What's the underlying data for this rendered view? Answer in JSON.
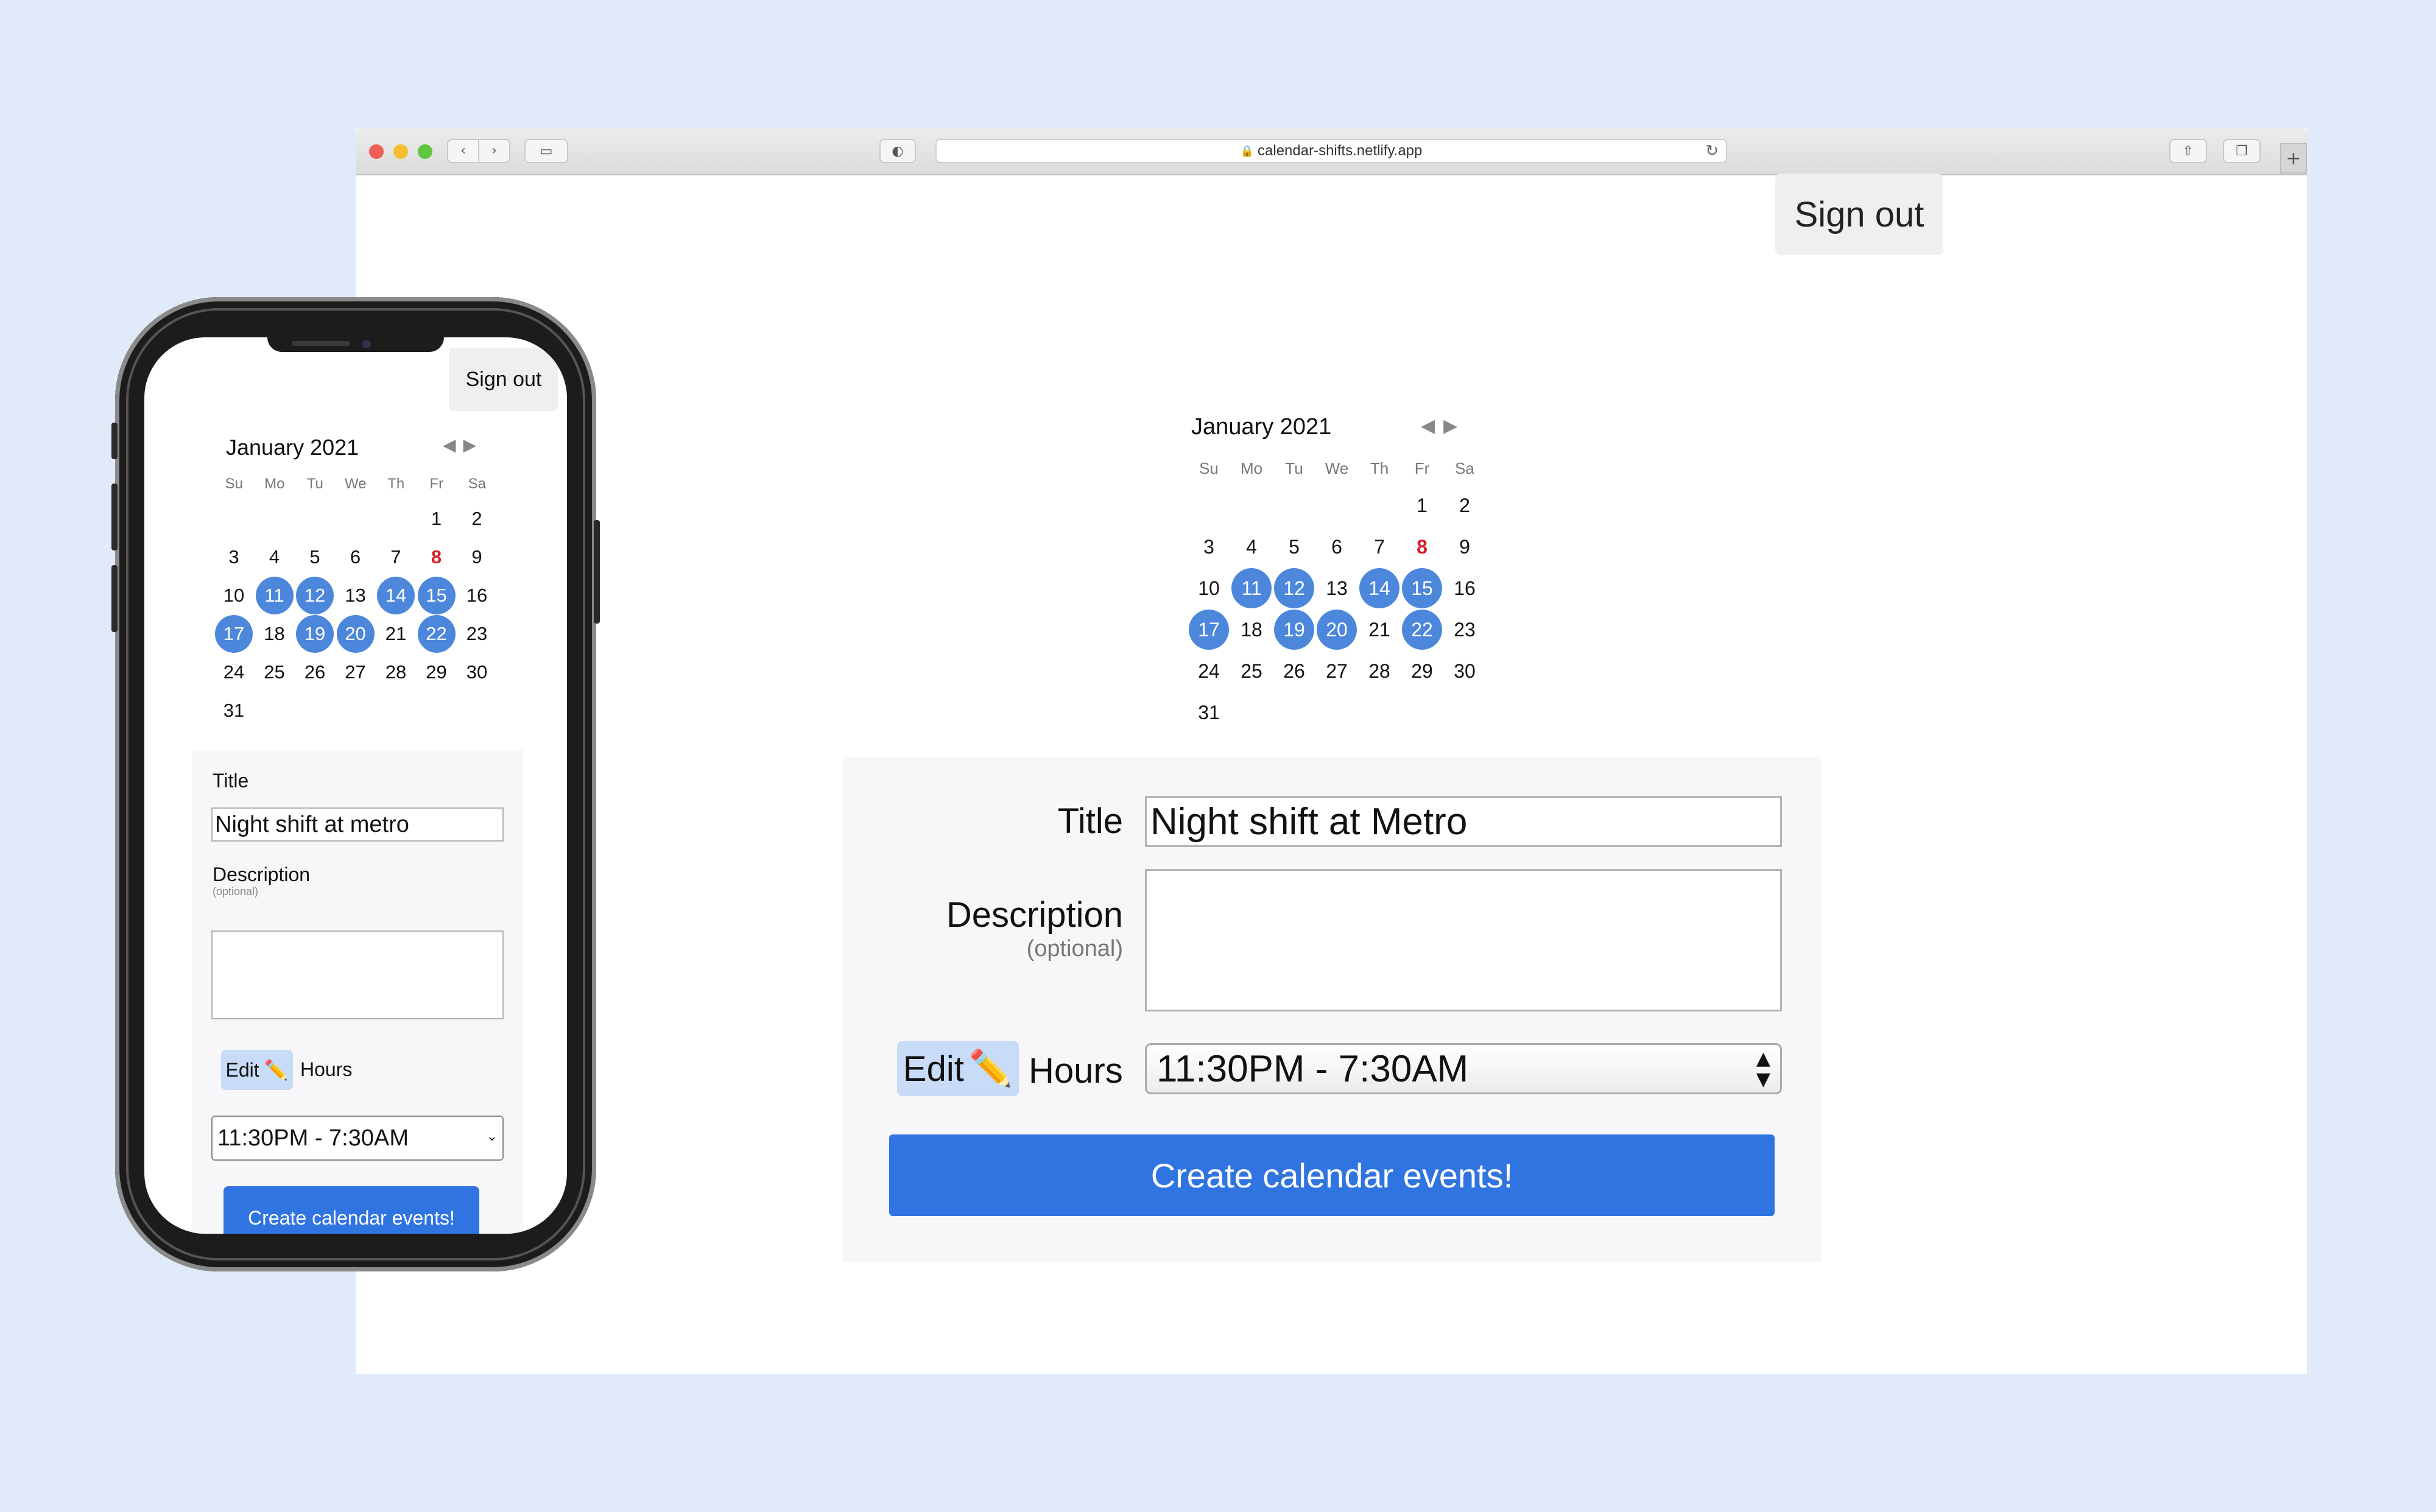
{
  "browser": {
    "url": "calendar-shifts.netlify.app",
    "nav_back_icon": "‹",
    "nav_forward_icon": "›",
    "sidebar_icon": "▭",
    "shield_icon": "◐",
    "share_icon": "⇧",
    "tabs_icon": "❐",
    "plus_icon": "+",
    "reload_icon": "↻",
    "lock_icon": "🔒"
  },
  "app": {
    "sign_out_label": "Sign out",
    "calendar": {
      "month_label": "January 2021",
      "prev_icon": "◀",
      "next_icon": "▶",
      "weekdays": [
        "Su",
        "Mo",
        "Tu",
        "We",
        "Th",
        "Fr",
        "Sa"
      ],
      "weeks": [
        [
          "",
          "",
          "",
          "",
          "",
          "1",
          "2"
        ],
        [
          "3",
          "4",
          "5",
          "6",
          "7",
          "8",
          "9"
        ],
        [
          "10",
          "11",
          "12",
          "13",
          "14",
          "15",
          "16"
        ],
        [
          "17",
          "18",
          "19",
          "20",
          "21",
          "22",
          "23"
        ],
        [
          "24",
          "25",
          "26",
          "27",
          "28",
          "29",
          "30"
        ],
        [
          "31",
          "",
          "",
          "",
          "",
          "",
          ""
        ]
      ],
      "selected_days": [
        "11",
        "12",
        "14",
        "15",
        "17",
        "19",
        "20",
        "22"
      ],
      "today": "8",
      "selected_color": "#4c87dc",
      "today_color": "#d1202a"
    },
    "form": {
      "title_label": "Title",
      "title_value_desktop": "Night shift at Metro",
      "title_value_mobile": "Night shift at metro",
      "description_label": "Description",
      "description_optional": "(optional)",
      "description_value": "",
      "edit_label": "Edit",
      "edit_icon": "✏️",
      "hours_label": "Hours",
      "hours_value": "11:30PM - 7:30AM",
      "select_arrow_desktop": "▲\n▼",
      "select_arrow_mobile": "⌄",
      "create_button_label": "Create calendar events!",
      "accent_color": "#2f74e0"
    }
  }
}
